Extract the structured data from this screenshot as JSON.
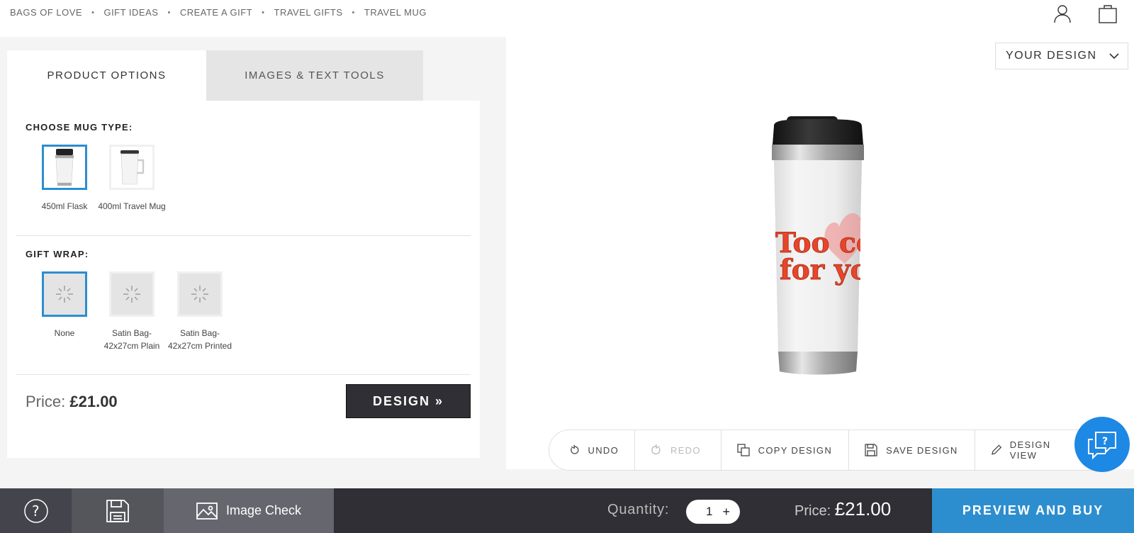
{
  "breadcrumb": [
    "BAGS OF LOVE",
    "GIFT IDEAS",
    "CREATE A GIFT",
    "TRAVEL GIFTS",
    "TRAVEL MUG"
  ],
  "tabs": {
    "product_options": "PRODUCT OPTIONS",
    "images_text_tools": "IMAGES & TEXT TOOLS"
  },
  "mug_type": {
    "title": "CHOOSE MUG TYPE:",
    "options": [
      {
        "label": "450ml Flask",
        "selected": true
      },
      {
        "label": "400ml Travel Mug",
        "selected": false
      }
    ]
  },
  "gift_wrap": {
    "title": "GIFT WRAP:",
    "options": [
      {
        "label": "None",
        "selected": true
      },
      {
        "label": "Satin Bag- 42x27cm Plain",
        "selected": false
      },
      {
        "label": "Satin Bag- 42x27cm Printed",
        "selected": false
      }
    ]
  },
  "panel_price": {
    "label": "Price:",
    "value": "£21.00"
  },
  "design_button": "DESIGN »",
  "your_design": "YOUR DESIGN",
  "mug_print_text": [
    "Too cool",
    "for you"
  ],
  "toolbar": {
    "undo": "UNDO",
    "redo": "REDO",
    "copy": "COPY DESIGN",
    "save": "SAVE DESIGN",
    "view": "DESIGN VIEW"
  },
  "bottom": {
    "image_check": "Image Check",
    "quantity_label": "Quantity:",
    "quantity_value": "1",
    "price_label": "Price:",
    "price_value": "£21.00",
    "preview_buy": "PREVIEW AND BUY"
  },
  "colors": {
    "accent": "#2d8ecf",
    "dark": "#2f2f35",
    "help_bubble": "#1e88e5",
    "print_text": "#e8452a"
  }
}
